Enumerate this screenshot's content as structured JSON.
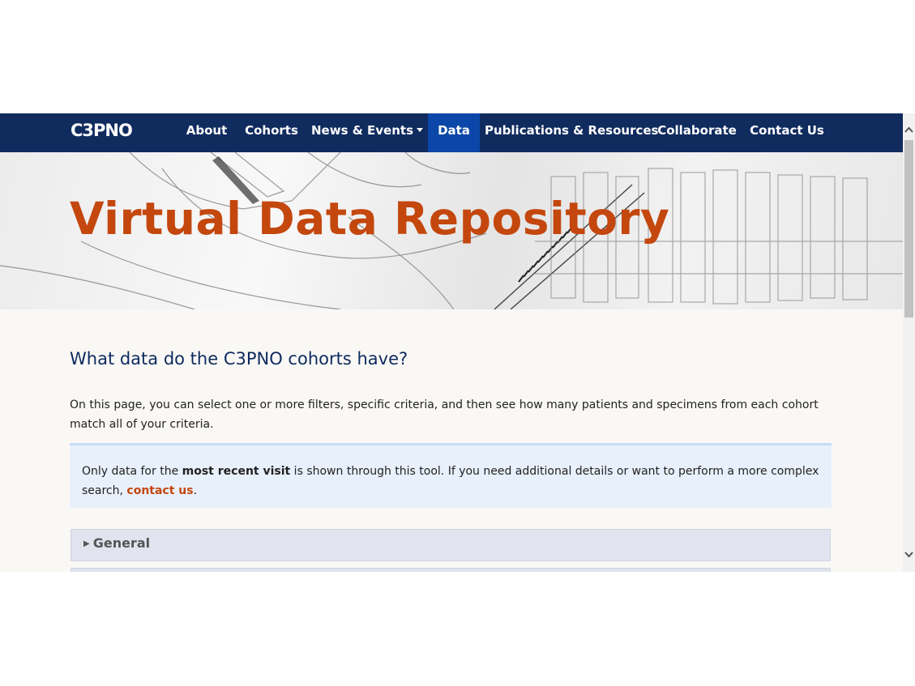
{
  "navbar": {
    "brand": "C3PNO",
    "items": [
      {
        "label": "About"
      },
      {
        "label": "Cohorts"
      },
      {
        "label": "News & Events"
      },
      {
        "label": "Data"
      },
      {
        "label": "Publications & Resources"
      },
      {
        "label": "Collaborate"
      },
      {
        "label": "Contact Us"
      }
    ],
    "active_item": "Data",
    "background_color": "#102b5e",
    "active_color": "#0b47a8"
  },
  "hero": {
    "title": "Virtual Data Repository",
    "title_color": "#c4470e"
  },
  "main": {
    "heading": "What data do the C3PNO cohorts have?",
    "intro": "On this page, you can select one or more filters, specific criteria, and then see how many patients and specimens from each cohort match all of your criteria.",
    "notice": {
      "prefix": "Only data for the ",
      "emphasis": "most recent visit",
      "middle": " is shown through this tool. If you need additional details or want to perform a more complex search, ",
      "link": "contact us",
      "suffix": "."
    },
    "accordions": [
      {
        "label": "General",
        "expanded": false
      }
    ]
  },
  "icons": {
    "dropdown_caret": "caret-down-icon",
    "accordion_arrow": "triangle-right-icon",
    "scroll_up": "chevron-up-icon",
    "scroll_down": "chevron-down-icon"
  }
}
